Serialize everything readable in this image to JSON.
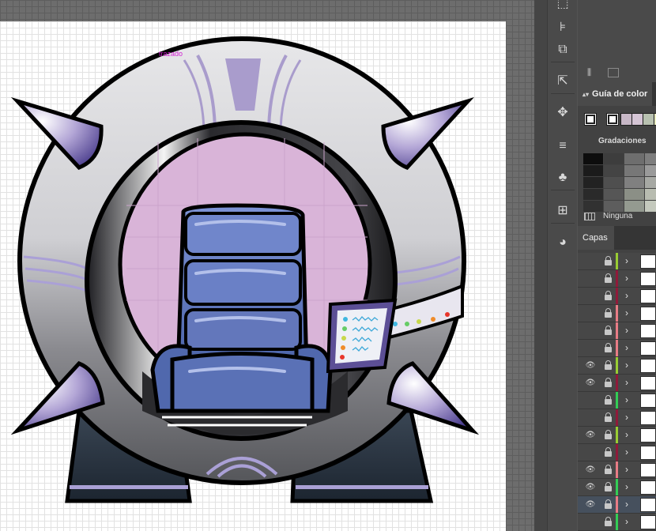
{
  "canvas": {
    "path_label": "trazado"
  },
  "toolbar": {
    "tools": [
      {
        "name": "transform-icon",
        "glyph": "⬚"
      },
      {
        "name": "align-icon",
        "glyph": "⊧"
      },
      {
        "name": "pathfinder-icon",
        "glyph": "⧉"
      },
      {
        "name": "export-icon",
        "glyph": "⇱"
      },
      {
        "name": "puppet-warp-icon",
        "glyph": "✥"
      },
      {
        "name": "stroke-icon",
        "glyph": "≡"
      },
      {
        "name": "symbols-icon",
        "glyph": "♣"
      },
      {
        "name": "distribute-icon",
        "glyph": "⊞"
      },
      {
        "name": "palette-icon",
        "glyph": "◕"
      }
    ]
  },
  "panels": {
    "libraries_icons": [
      "libraries-icon",
      "place-icon"
    ],
    "color_guide": {
      "tab_label": "Guía de color",
      "swatches": [
        "#ffffff",
        "#ffffff",
        "#c7b7c6",
        "#d5c5d5",
        "#b8c1b0",
        "#ecf0c4"
      ],
      "gradations_label": "Gradaciones",
      "grid_colors": [
        [
          "#0d0d0d",
          "#3d3d3d",
          "#6e6e6e",
          "#7e7e7e"
        ],
        [
          "#1b1b1b",
          "#444444",
          "#777777",
          "#9a9a9a"
        ],
        [
          "#222222",
          "#4f4f4f",
          "#808080",
          "#a7a9a4"
        ],
        [
          "#2a2a2a",
          "#565656",
          "#8b8f86",
          "#b8bcb0"
        ],
        [
          "#313131",
          "#5d5d5d",
          "#949a90",
          "#c4c9bd"
        ]
      ],
      "footer_label": "Ninguna"
    },
    "layers": {
      "tab_label": "Capas",
      "rows": [
        {
          "visible": false,
          "color": "#99cc33",
          "selected": false
        },
        {
          "visible": false,
          "color": "#8f1a3a",
          "selected": false
        },
        {
          "visible": false,
          "color": "#8f1a3a",
          "selected": false
        },
        {
          "visible": false,
          "color": "#e87c86",
          "selected": false
        },
        {
          "visible": false,
          "color": "#e87c86",
          "selected": false
        },
        {
          "visible": false,
          "color": "#e87c86",
          "selected": false
        },
        {
          "visible": true,
          "color": "#99cc33",
          "selected": false
        },
        {
          "visible": true,
          "color": "#8f1a3a",
          "selected": false
        },
        {
          "visible": false,
          "color": "#33cc55",
          "selected": false
        },
        {
          "visible": false,
          "color": "#8f1a3a",
          "selected": false
        },
        {
          "visible": true,
          "color": "#99cc33",
          "selected": false
        },
        {
          "visible": false,
          "color": "#8f1a3a",
          "selected": false
        },
        {
          "visible": true,
          "color": "#e87c86",
          "selected": false
        },
        {
          "visible": true,
          "color": "#33cc55",
          "selected": false
        },
        {
          "visible": true,
          "color": "#e87c86",
          "selected": true
        },
        {
          "visible": false,
          "color": "#33cc55",
          "selected": false
        }
      ]
    }
  }
}
